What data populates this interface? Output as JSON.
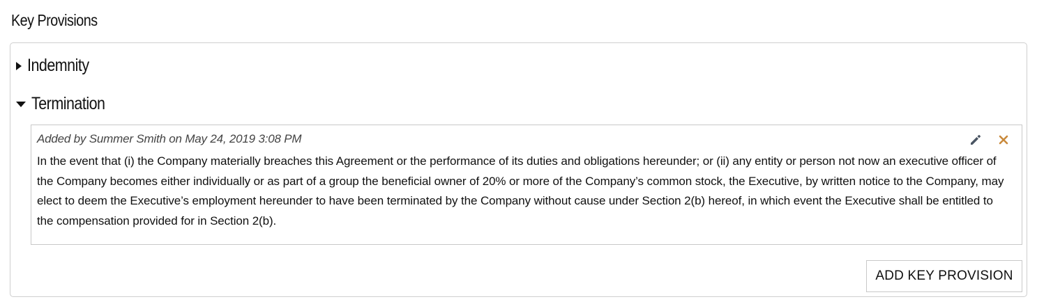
{
  "header": {
    "title": "Key Provisions"
  },
  "accordion": {
    "items": [
      {
        "label": "Indemnity",
        "expanded": false
      },
      {
        "label": "Termination",
        "expanded": true
      }
    ]
  },
  "termination_entry": {
    "meta": "Added by Summer Smith on May 24, 2019 3:08 PM",
    "text": "In the event that (i) the Company materially breaches this Agreement or the performance of its duties and obligations hereunder; or (ii) any entity or person not now an executive officer of the Company becomes either individually or as part of a group the beneficial owner of 20% or more of the Company’s common stock, the Executive, by written notice to the Company, may elect to deem the Executive’s employment hereunder to have been terminated by the Company without cause under Section 2(b) hereof, in which event the Executive shall be entitled to the compensation provided for in Section 2(b).",
    "icons": {
      "edit": "pencil-icon",
      "delete": "close-icon"
    }
  },
  "actions": {
    "add_label": "ADD KEY PROVISION"
  },
  "colors": {
    "edit_icon": "#4a5563",
    "delete_icon": "#c98a3c",
    "border": "#cfcfcf"
  }
}
